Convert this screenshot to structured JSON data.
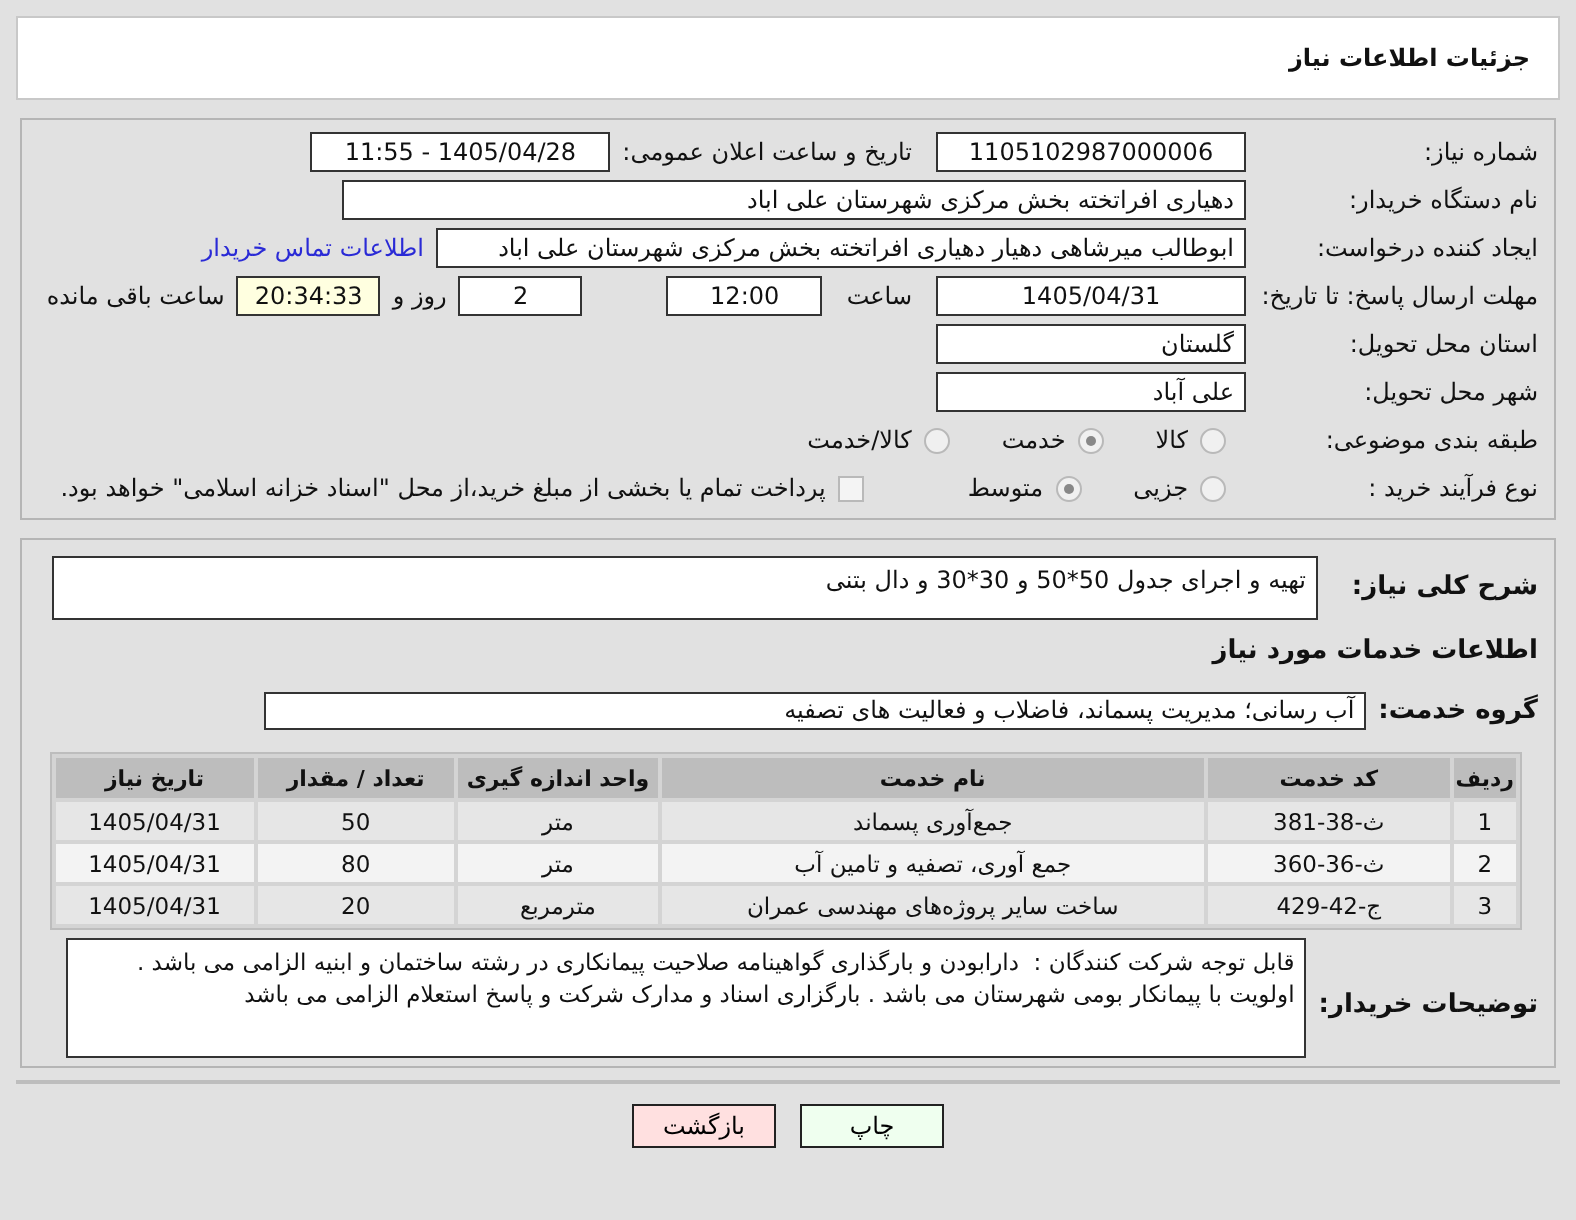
{
  "header": {
    "title": "جزئیات اطلاعات نیاز"
  },
  "need_info": {
    "need_number": {
      "label": "شماره نیاز:",
      "value": "1105102987000006"
    },
    "announce_datetime": {
      "label": "تاریخ و ساعت اعلان عمومی:",
      "value": "1405/04/28 - 11:55"
    },
    "buyer_org": {
      "label": "نام دستگاه خریدار:",
      "value": "دهیاری افراتخته بخش مرکزی شهرستان علی اباد"
    },
    "requester": {
      "label": "ایجاد کننده درخواست:",
      "value": "ابوطالب میرشاهی دهیار دهیاری افراتخته بخش مرکزی شهرستان علی اباد",
      "link": "اطلاعات تماس خریدار"
    },
    "deadline": {
      "label": "مهلت ارسال پاسخ: تا تاریخ:",
      "date": "1405/04/31",
      "time_label": "ساعت",
      "time": "12:00",
      "days": "2",
      "days_label": "روز و",
      "remaining": "20:34:33",
      "remaining_label": "ساعت باقی مانده"
    },
    "province": {
      "label": "استان محل تحویل:",
      "value": "گلستان"
    },
    "city": {
      "label": "شهر محل تحویل:",
      "value": "علی آباد"
    },
    "category": {
      "label": "طبقه بندی موضوعی:",
      "options": [
        {
          "label": "کالا",
          "selected": false
        },
        {
          "label": "خدمت",
          "selected": true
        },
        {
          "label": "کالا/خدمت",
          "selected": false
        }
      ]
    },
    "purchase_type": {
      "label": "نوع فرآیند خرید :",
      "options": [
        {
          "label": "جزیی",
          "selected": false
        },
        {
          "label": "متوسط",
          "selected": true
        }
      ],
      "payment_note": {
        "checked": false,
        "text": "پرداخت تمام یا بخشی از مبلغ خرید،از محل \"اسناد خزانه اسلامی\" خواهد بود."
      }
    }
  },
  "details": {
    "summary": {
      "label": "شرح کلی نیاز:",
      "value": "تهیه و اجرای جدول 50*50 و 30*30 و دال بتنی"
    },
    "services_heading": "اطلاعات خدمات مورد نیاز",
    "service_group": {
      "label": "گروه خدمت:",
      "value": "آب رسانی؛ مدیریت پسماند، فاضلاب و فعالیت های تصفیه"
    },
    "table": {
      "columns": [
        "ردیف",
        "کد خدمت",
        "نام خدمت",
        "واحد اندازه گیری",
        "تعداد / مقدار",
        "تاریخ نیاز"
      ],
      "rows": [
        [
          "1",
          "ث-38-381",
          "جمع‌آوری پسماند",
          "متر",
          "50",
          "1405/04/31"
        ],
        [
          "2",
          "ث-36-360",
          "جمع آوری، تصفیه و تامین آب",
          "متر",
          "80",
          "1405/04/31"
        ],
        [
          "3",
          "ج-42-429",
          "ساخت سایر پروژه‌های مهندسی عمران",
          "مترمربع",
          "20",
          "1405/04/31"
        ]
      ]
    },
    "buyer_notes": {
      "label": "توضیحات خریدار:",
      "value": "قابل توجه شرکت کنندگان :  دارابودن و بارگذاری گواهینامه صلاحیت پیمانکاری در رشته ساختمان و ابنیه الزامی می باشد .\nاولویت با پیمانکار بومی شهرستان می باشد . بارگزاری اسناد و مدارک شرکت و پاسخ استعلام الزامی می باشد"
    }
  },
  "buttons": [
    {
      "label": "چاپ",
      "kind": "print"
    },
    {
      "label": "بازگشت",
      "kind": "back"
    }
  ]
}
